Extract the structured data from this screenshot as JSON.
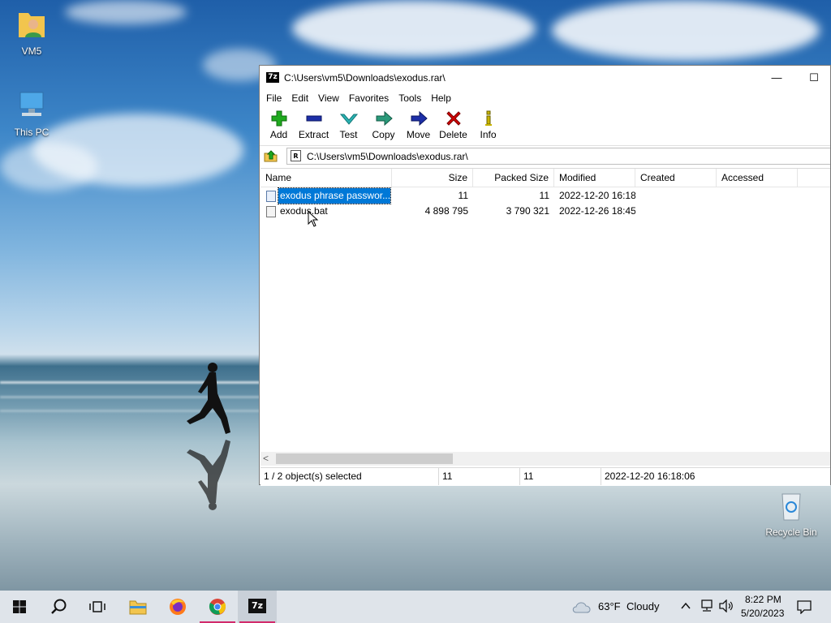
{
  "desktop": {
    "icons": [
      {
        "label": "VM5"
      },
      {
        "label": "This PC"
      },
      {
        "label": "Recycle Bin"
      }
    ]
  },
  "window": {
    "title": "C:\\Users\\vm5\\Downloads\\exodus.rar\\",
    "app_icon": "7z",
    "minimize_glyph": "—",
    "maximize_glyph": "☐",
    "menu": [
      "File",
      "Edit",
      "View",
      "Favorites",
      "Tools",
      "Help"
    ],
    "toolbar": [
      {
        "label": "Add",
        "icon": "plus-icon",
        "color": "#1faa1f"
      },
      {
        "label": "Extract",
        "icon": "minus-icon",
        "color": "#1d2fa8"
      },
      {
        "label": "Test",
        "icon": "check-chevron-icon",
        "color": "#2bb3b3"
      },
      {
        "label": "Copy",
        "icon": "arrow-right-icon",
        "color": "#2a9a7a"
      },
      {
        "label": "Move",
        "icon": "arrow-right-icon",
        "color": "#1d2fa8"
      },
      {
        "label": "Delete",
        "icon": "x-icon",
        "color": "#d40000"
      },
      {
        "label": "Info",
        "icon": "info-icon",
        "color": "#c8b400"
      }
    ],
    "address": {
      "path": "C:\\Users\\vm5\\Downloads\\exodus.rar\\",
      "archive_icon": "R"
    },
    "columns": [
      "Name",
      "Size",
      "Packed Size",
      "Modified",
      "Created",
      "Accessed"
    ],
    "rows": [
      {
        "name": "exodus phrase passwor...",
        "size": "11",
        "packed": "11",
        "modified": "2022-12-20 16:18",
        "selected": true
      },
      {
        "name": "exodus.bat",
        "size": "4 898 795",
        "packed": "3 790 321",
        "modified": "2022-12-26 18:45",
        "selected": false
      }
    ],
    "scroll_arrow": "<",
    "status": {
      "selection": "1 / 2 object(s) selected",
      "size": "11",
      "packed": "11",
      "modified": "2022-12-20 16:18:06"
    }
  },
  "taskbar": {
    "weather": {
      "temp": "63°F",
      "condition": "Cloudy"
    },
    "tray_chevron": "^",
    "time": "8:22 PM",
    "date": "5/20/2023",
    "app_7z_label": "7z",
    "accent": "#0078d7"
  }
}
